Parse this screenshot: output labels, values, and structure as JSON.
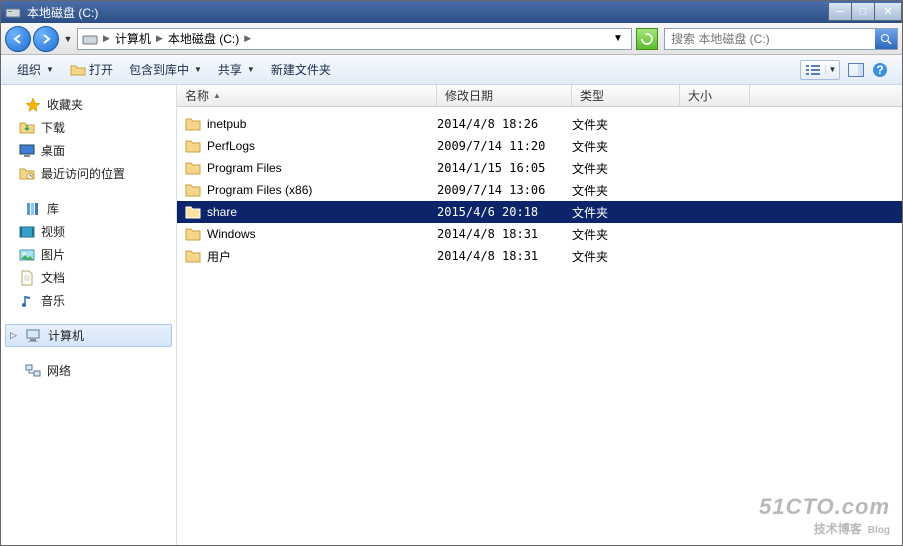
{
  "titlebar": {
    "title": "本地磁盘 (C:)"
  },
  "nav": {
    "breadcrumb": [
      "计算机",
      "本地磁盘 (C:)"
    ],
    "search_placeholder": "搜索 本地磁盘 (C:)"
  },
  "toolbar": {
    "organize": "组织",
    "open": "打开",
    "include": "包含到库中",
    "share": "共享",
    "newfolder": "新建文件夹"
  },
  "tree": {
    "favorites": {
      "label": "收藏夹",
      "items": [
        "下载",
        "桌面",
        "最近访问的位置"
      ]
    },
    "libraries": {
      "label": "库",
      "items": [
        "视频",
        "图片",
        "文档",
        "音乐"
      ]
    },
    "computer": {
      "label": "计算机"
    },
    "network": {
      "label": "网络"
    }
  },
  "columns": {
    "name": "名称",
    "date": "修改日期",
    "type": "类型",
    "size": "大小"
  },
  "rows": [
    {
      "name": "inetpub",
      "date": "2014/4/8 18:26",
      "type": "文件夹",
      "selected": false
    },
    {
      "name": "PerfLogs",
      "date": "2009/7/14 11:20",
      "type": "文件夹",
      "selected": false
    },
    {
      "name": "Program Files",
      "date": "2014/1/15 16:05",
      "type": "文件夹",
      "selected": false
    },
    {
      "name": "Program Files (x86)",
      "date": "2009/7/14 13:06",
      "type": "文件夹",
      "selected": false
    },
    {
      "name": "share",
      "date": "2015/4/6 20:18",
      "type": "文件夹",
      "selected": true
    },
    {
      "name": "Windows",
      "date": "2014/4/8 18:31",
      "type": "文件夹",
      "selected": false
    },
    {
      "name": "用户",
      "date": "2014/4/8 18:31",
      "type": "文件夹",
      "selected": false
    }
  ],
  "watermark": {
    "line1": "51CTO.com",
    "line2": "技术博客",
    "line2b": "Blog"
  }
}
